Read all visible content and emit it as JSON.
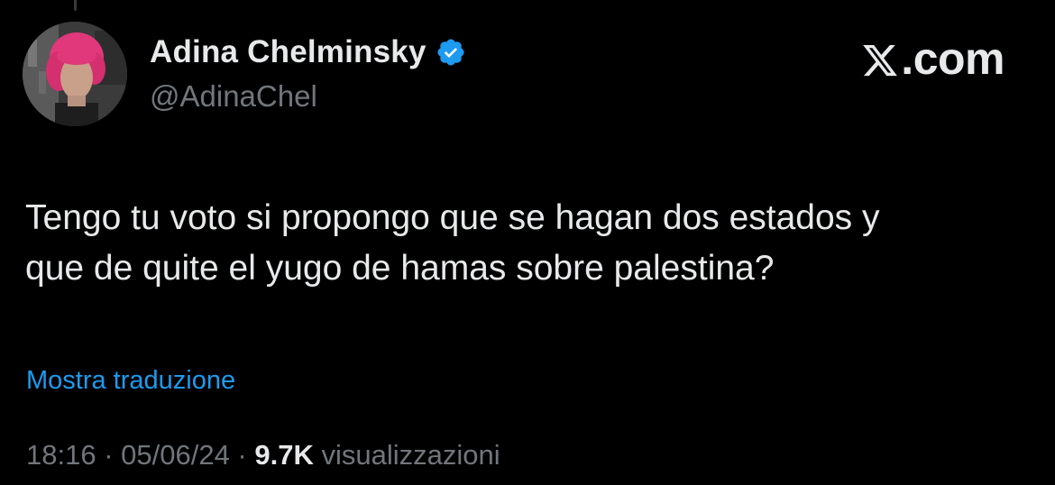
{
  "author": {
    "display_name": "Adina Chelminsky",
    "handle": "@AdinaChel",
    "verified": true
  },
  "brand": {
    "label": ".com",
    "icon": "x-logo-icon"
  },
  "tweet": {
    "text": "Tengo tu voto si propongo que se hagan dos estados y\nque de quite el yugo de hamas sobre palestina?",
    "translate_label": "Mostra traduzione"
  },
  "meta": {
    "time": "18:16",
    "separator": " · ",
    "date": "05/06/24",
    "views_count": "9.7K",
    "views_label": "visualizzazioni"
  },
  "colors": {
    "background": "#000000",
    "text": "#e7e9ea",
    "muted": "#71767b",
    "link": "#1d9bf0",
    "verified": "#1d9bf0",
    "avatar_hair": "#e0387a"
  }
}
